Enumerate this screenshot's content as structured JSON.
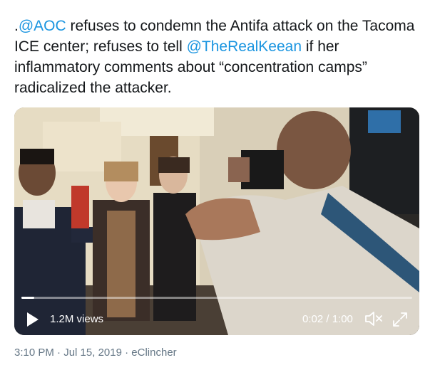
{
  "tweet": {
    "text_prefix": ".",
    "mention_1": "@AOC",
    "text_middle": " refuses to condemn the Antifa attack on the Tacoma ICE center; refuses to tell ",
    "mention_2": "@TheRealKeean",
    "text_suffix": " if her inflammatory comments about “concentration camps” radicalized the attacker."
  },
  "video": {
    "views": "1.2M views",
    "time": "0:02 / 1:00",
    "progress": 0.033,
    "icons": [
      "play-icon",
      "mute-icon",
      "expand-icon"
    ]
  },
  "meta": {
    "time": "3:10 PM",
    "sep1": " · ",
    "date": "Jul 15, 2019",
    "sep2": " · ",
    "source": "eClincher"
  },
  "colors": {
    "mention": "#1b95e0",
    "text": "#14171a",
    "meta": "#657786"
  }
}
